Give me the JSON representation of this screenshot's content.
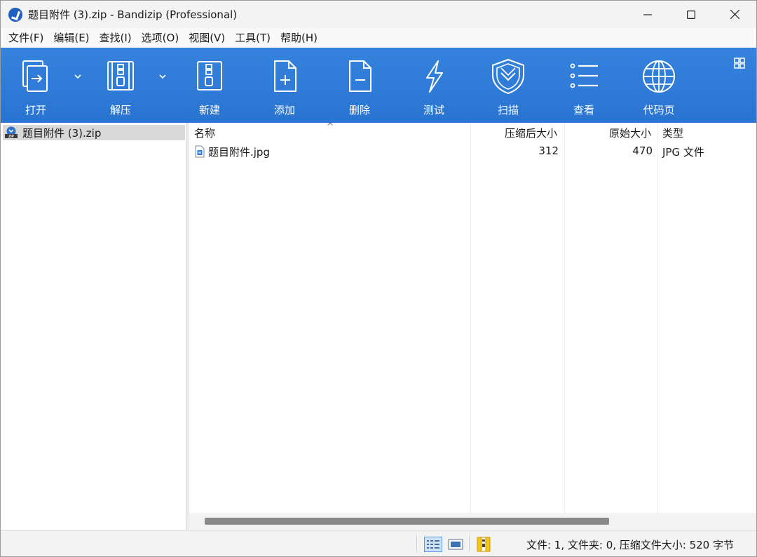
{
  "window": {
    "title": "题目附件 (3).zip - Bandizip (Professional)",
    "controls": {
      "minimize": "—",
      "maximize": "☐",
      "close": "✕"
    }
  },
  "menu": [
    {
      "label": "文件(F)"
    },
    {
      "label": "编辑(E)"
    },
    {
      "label": "查找(I)"
    },
    {
      "label": "选项(O)"
    },
    {
      "label": "视图(V)"
    },
    {
      "label": "工具(T)"
    },
    {
      "label": "帮助(H)"
    }
  ],
  "toolbar": {
    "accent_color": "#2e7bd9",
    "buttons": [
      {
        "label": "打开",
        "icon": "open-icon"
      },
      {
        "label": "解压",
        "icon": "extract-icon"
      },
      {
        "label": "新建",
        "icon": "new-archive-icon"
      },
      {
        "label": "添加",
        "icon": "add-icon"
      },
      {
        "label": "删除",
        "icon": "delete-icon"
      },
      {
        "label": "测试",
        "icon": "test-icon"
      },
      {
        "label": "扫描",
        "icon": "scan-icon"
      },
      {
        "label": "查看",
        "icon": "view-icon"
      },
      {
        "label": "代码页",
        "icon": "codepage-icon"
      }
    ]
  },
  "tree": {
    "items": [
      {
        "label": "题目附件 (3).zip",
        "icon": "zip-icon"
      }
    ]
  },
  "filelist": {
    "columns": {
      "name": "名称",
      "packed": "压缩后大小",
      "original": "原始大小",
      "type": "类型"
    },
    "rows": [
      {
        "name": "题目附件.jpg",
        "packed": "312",
        "original": "470",
        "type": "JPG 文件",
        "icon": "jpg-file-icon"
      }
    ]
  },
  "status": {
    "text": "文件: 1, 文件夹: 0, 压缩文件大小: 520 字节"
  }
}
